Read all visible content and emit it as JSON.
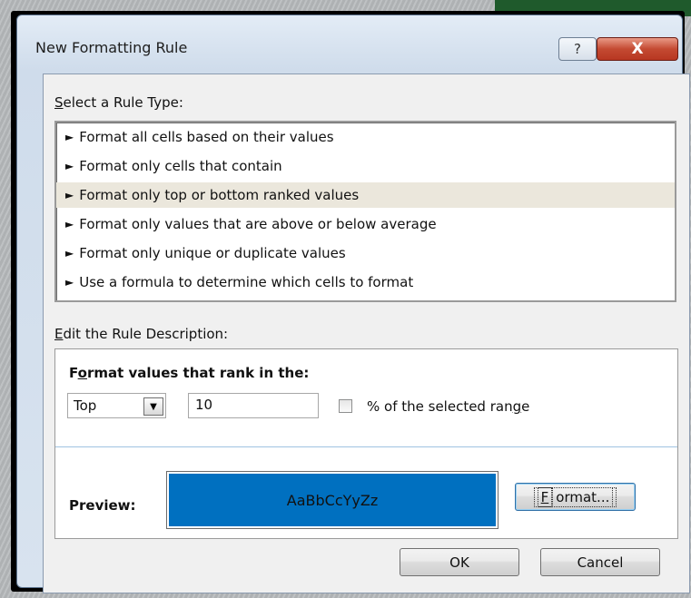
{
  "dialog": {
    "title": "New Formatting Rule",
    "help_glyph": "?",
    "close_glyph": "X"
  },
  "rule_type": {
    "label_accel": "S",
    "label_rest": "elect a Rule Type:",
    "marker": "►",
    "items": [
      "Format all cells based on their values",
      "Format only cells that contain",
      "Format only top or bottom ranked values",
      "Format only values that are above or below average",
      "Format only unique or duplicate values",
      "Use a formula to determine which cells to format"
    ],
    "selected_index": 2
  },
  "description": {
    "label_accel": "E",
    "label_rest": "dit the Rule Description:",
    "head_pre": "F",
    "head_accel": "o",
    "head_rest": "rmat values that rank in the:",
    "rank_select": {
      "value": "Top",
      "arrow": "▼"
    },
    "rank_value": "10",
    "percent_checked": false,
    "percent_label_pre": "% of the selected ran",
    "percent_label_accel": "g",
    "percent_label_post": "e",
    "preview_label": "Preview:",
    "preview_sample": "AaBbCcYyZz",
    "preview_color": "#0070c0",
    "format_button_accel": "F",
    "format_button_rest": "ormat..."
  },
  "footer": {
    "ok_label": "OK",
    "cancel_label": "Cancel"
  }
}
